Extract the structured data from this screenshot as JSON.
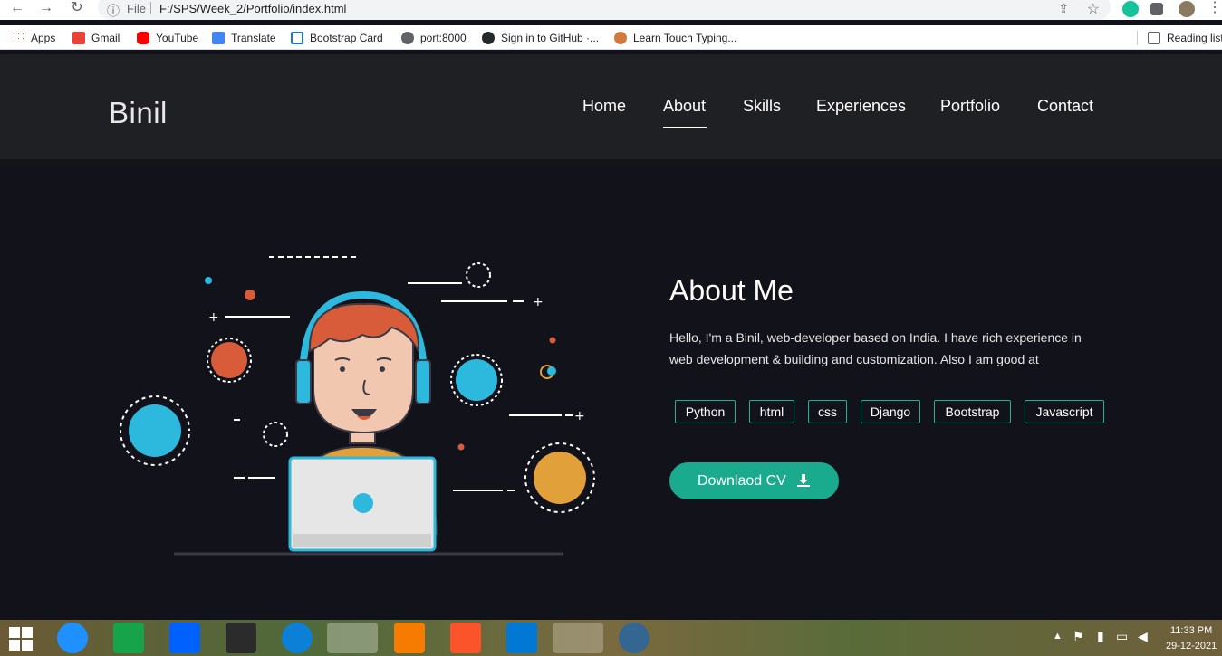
{
  "browser": {
    "info_glyph": "ⓘ",
    "scheme": "File",
    "url": "F:/SPS/Week_2/Portfolio/index.html",
    "bookmarks": [
      {
        "label": "Apps"
      },
      {
        "label": "Gmail"
      },
      {
        "label": "YouTube"
      },
      {
        "label": "Translate"
      },
      {
        "label": "Bootstrap Card"
      },
      {
        "label": "port:8000"
      },
      {
        "label": "Sign in to GitHub ·..."
      },
      {
        "label": "Learn Touch Typing..."
      }
    ],
    "reading_list": "Reading list"
  },
  "site": {
    "brand": "Binil",
    "menu": [
      "Home",
      "About",
      "Skills",
      "Experiences",
      "Portfolio",
      "Contact"
    ],
    "active_menu": "About"
  },
  "about": {
    "title": "About Me",
    "text": "Hello, I'm a Binil, web-developer based on India. I have rich experience in web development & building and customization. Also I am good at",
    "skills": [
      "Python",
      "html",
      "css",
      "Django",
      "Bootstrap",
      "Javascript"
    ],
    "cv_button": "Downlaod CV"
  },
  "taskbar": {
    "time": "11:33 PM",
    "date": "29-12-2021"
  },
  "colors": {
    "accent": "#1aab8f",
    "page_bg": "#12121a",
    "header_bg": "#1f2024"
  }
}
